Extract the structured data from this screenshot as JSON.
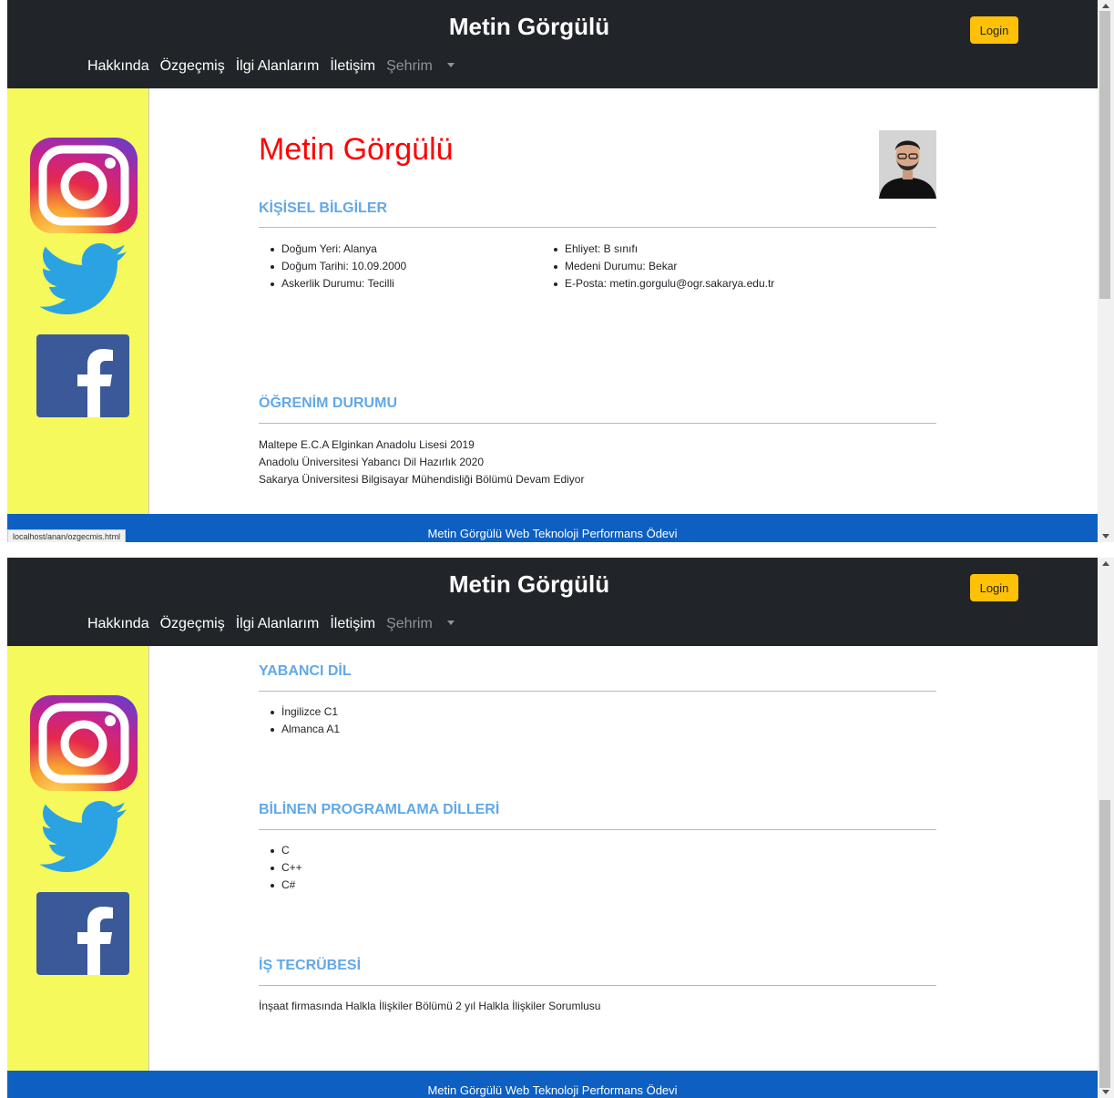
{
  "navbar": {
    "brand": "Metin Görgülü",
    "login_label": "Login",
    "menu": [
      "Hakkında",
      "Özgeçmiş",
      "İlgi Alanlarım",
      "İletişim"
    ],
    "city_dropdown": "Şehrim"
  },
  "sidebar": {
    "icons": [
      "instagram-icon",
      "twitter-icon",
      "facebook-icon"
    ]
  },
  "profile": {
    "name": "Metin Görgülü"
  },
  "personal": {
    "title": "KİŞİSEL BİLGİLER",
    "left": [
      "Doğum Yeri: Alanya",
      "Doğum Tarihi: 10.09.2000",
      "Askerlik Durumu: Tecilli"
    ],
    "right": [
      "Ehliyet: B sınıfı",
      "Medeni Durumu: Bekar",
      "E-Posta: metin.gorgulu@ogr.sakarya.edu.tr"
    ]
  },
  "education": {
    "title": "ÖĞRENİM DURUMU",
    "items": [
      "Maltepe E.C.A Elginkan Anadolu Lisesi 2019",
      "Anadolu Üniversitesi Yabancı Dil Hazırlık 2020",
      "Sakarya Üniversitesi Bilgisayar Mühendisliği Bölümü Devam Ediyor"
    ]
  },
  "languages": {
    "title": "YABANCI DİL",
    "items": [
      "İngilizce C1",
      "Almanca A1"
    ]
  },
  "programming": {
    "title": "BİLİNEN PROGRAMLAMA DİLLERİ",
    "items": [
      "C",
      "C++",
      "C#"
    ]
  },
  "experience": {
    "title": "İŞ TECRÜBESİ",
    "text": "İnşaat firmasında Halkla İlişkiler Bölümü 2 yıl Halkla İlişkiler Sorumlusu"
  },
  "footer": {
    "text": "Metin Görgülü Web Teknoloji Performans Ödevi"
  },
  "statusbar": {
    "url": "localhost/anan/ozgecmis.html"
  },
  "colors": {
    "navbar": "#212529",
    "login_button": "#ffc107",
    "sidebar": "#f5f95c",
    "footer": "#0d5fc2",
    "name": "#ff0000",
    "section_title": "#62a8e8"
  }
}
